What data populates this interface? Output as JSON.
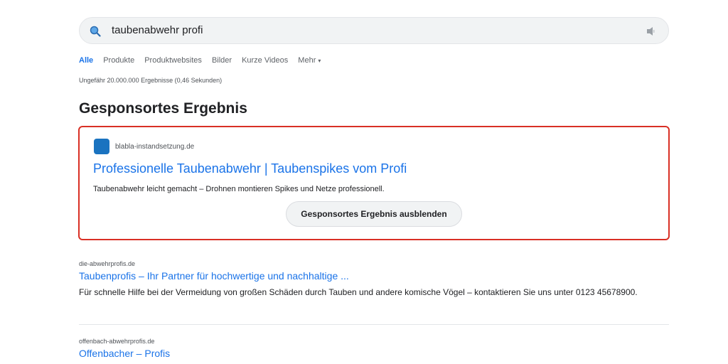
{
  "search": {
    "query": "taubenabwehr profi"
  },
  "tabs": [
    {
      "label": "Alle"
    },
    {
      "label": "Produkte"
    },
    {
      "label": "Produktwebsites"
    },
    {
      "label": "Bilder"
    },
    {
      "label": "Kurze Videos"
    },
    {
      "label": "Mehr"
    }
  ],
  "stats": "Ungefähr 20.000.000 Ergebnisse (0,46 Sekunden)",
  "sponsored": {
    "heading": "Gesponsortes Ergebnis",
    "domain": "blabla-instandsetzung.de",
    "title": "Professionelle Taubenabwehr | Taubenspikes vom Profi",
    "description": "Taubenabwehr leicht gemacht – Drohnen montieren Spikes und Netze professionell.",
    "hide_button": "Gesponsortes Ergebnis ausblenden",
    "border_color": "#d93025",
    "favicon_color": "#1a73c0"
  },
  "results": [
    {
      "domain": "die-abwehrprofis.de",
      "title": "Taubenprofis – Ihr Partner für hochwertige und nachhaltige ...",
      "snippet": "Für schnelle Hilfe bei der Vermeidung von großen Schäden durch Tauben und andere komische Vögel – kontaktieren Sie uns unter 0123 45678900."
    },
    {
      "domain": "offenbach-abwehrprofis.de",
      "title": "Offenbacher – Profis"
    }
  ],
  "colors": {
    "link": "#1a73e8",
    "accent_tab": "#1a73e8"
  },
  "icons": {
    "search": "search-icon",
    "mic": "microphone-icon",
    "caret": "caret-down-icon"
  }
}
